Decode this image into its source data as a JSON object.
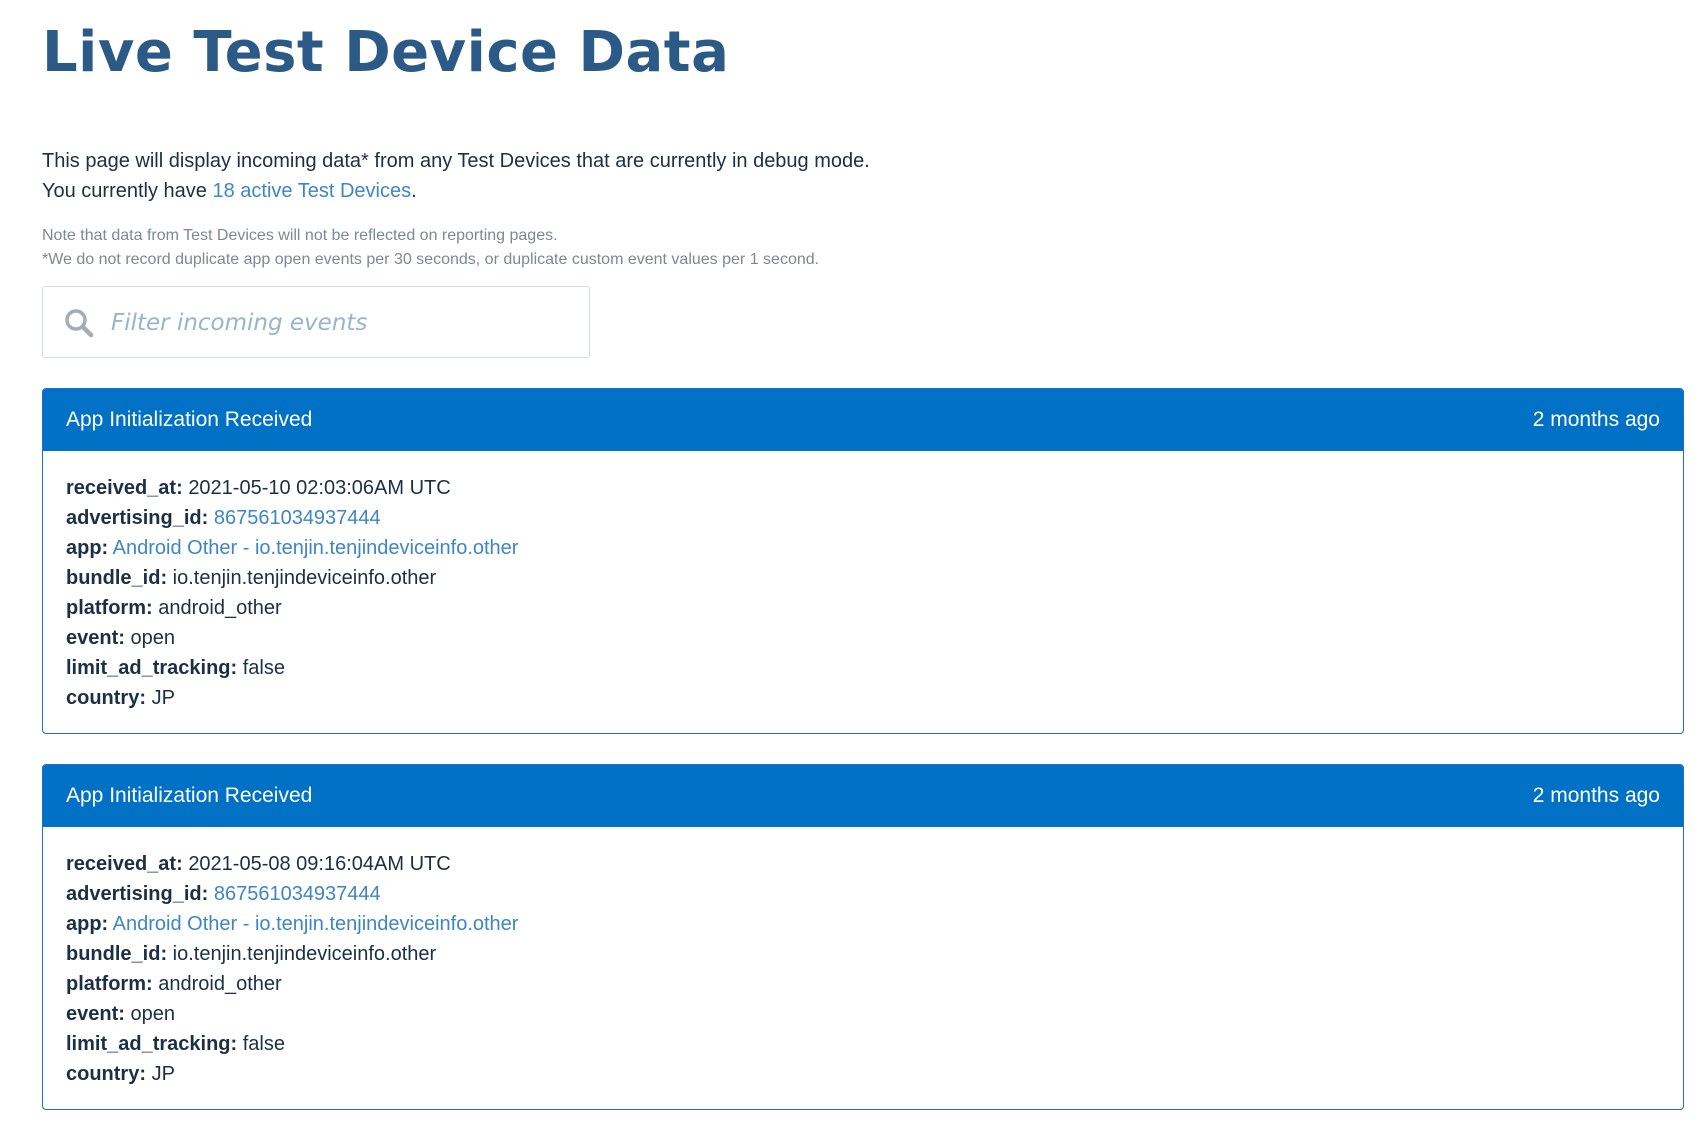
{
  "page": {
    "title": "Live Test Device Data",
    "intro_line1": "This page will display incoming data* from any Test Devices that are currently in debug mode.",
    "intro_line2_prefix": "You currently have ",
    "intro_line2_link": "18 active Test Devices",
    "intro_line2_suffix": ".",
    "note_line1": "Note that data from Test Devices will not be reflected on reporting pages.",
    "note_line2": "*We do not record duplicate app open events per 30 seconds, or duplicate custom event values per 1 second."
  },
  "search": {
    "placeholder": "Filter incoming events",
    "icon": "search-icon"
  },
  "colors": {
    "title": "#2a5a85",
    "card_header_bg": "#0071c5",
    "link": "#3f85c6",
    "note_text": "#7d8893",
    "placeholder": "#98b3cd"
  },
  "events": [
    {
      "title": "App Initialization Received",
      "time_ago": "2 months ago",
      "fields": [
        {
          "key": "received_at:",
          "value": "2021-05-10 02:03:06AM UTC",
          "link": false
        },
        {
          "key": "advertising_id:",
          "value": "867561034937444",
          "link": true
        },
        {
          "key": "app:",
          "value": "Android Other - io.tenjin.tenjindeviceinfo.other",
          "link": true
        },
        {
          "key": "bundle_id:",
          "value": "io.tenjin.tenjindeviceinfo.other",
          "link": false
        },
        {
          "key": "platform:",
          "value": "android_other",
          "link": false
        },
        {
          "key": "event:",
          "value": "open",
          "link": false
        },
        {
          "key": "limit_ad_tracking:",
          "value": "false",
          "link": false
        },
        {
          "key": "country:",
          "value": "JP",
          "link": false
        }
      ]
    },
    {
      "title": "App Initialization Received",
      "time_ago": "2 months ago",
      "fields": [
        {
          "key": "received_at:",
          "value": "2021-05-08 09:16:04AM UTC",
          "link": false
        },
        {
          "key": "advertising_id:",
          "value": "867561034937444",
          "link": true
        },
        {
          "key": "app:",
          "value": "Android Other - io.tenjin.tenjindeviceinfo.other",
          "link": true
        },
        {
          "key": "bundle_id:",
          "value": "io.tenjin.tenjindeviceinfo.other",
          "link": false
        },
        {
          "key": "platform:",
          "value": "android_other",
          "link": false
        },
        {
          "key": "event:",
          "value": "open",
          "link": false
        },
        {
          "key": "limit_ad_tracking:",
          "value": "false",
          "link": false
        },
        {
          "key": "country:",
          "value": "JP",
          "link": false
        }
      ]
    }
  ]
}
